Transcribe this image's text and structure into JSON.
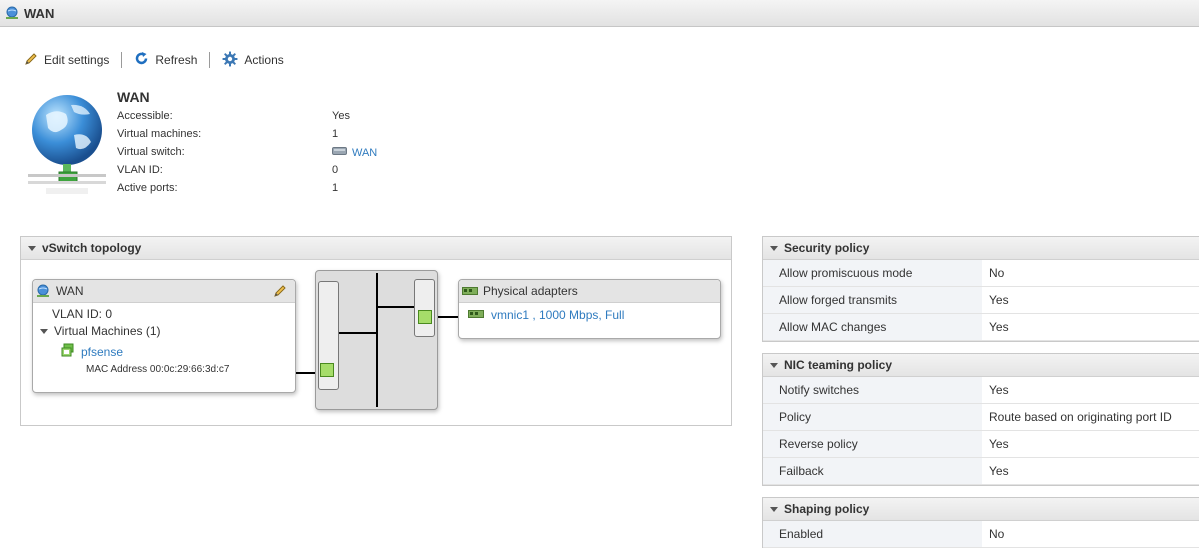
{
  "window": {
    "title": "WAN"
  },
  "toolbar": {
    "edit_label": "Edit settings",
    "refresh_label": "Refresh",
    "actions_label": "Actions"
  },
  "summary": {
    "name": "WAN",
    "fields": [
      {
        "label": "Accessible:",
        "value": "Yes"
      },
      {
        "label": "Virtual machines:",
        "value": "1"
      },
      {
        "label": "Virtual switch:",
        "value": "WAN"
      },
      {
        "label": "VLAN ID:",
        "value": "0"
      },
      {
        "label": "Active ports:",
        "value": "1"
      }
    ]
  },
  "topology": {
    "title": "vSwitch topology",
    "portgroup": {
      "name": "WAN",
      "vlan": "VLAN ID: 0",
      "vms_label": "Virtual Machines (1)",
      "vm_name": "pfsense",
      "mac": "MAC Address 00:0c:29:66:3d:c7"
    },
    "adapters": {
      "title": "Physical adapters",
      "nic": "vmnic1 , 1000 Mbps, Full"
    }
  },
  "security": {
    "title": "Security policy",
    "rows": [
      {
        "k": "Allow promiscuous mode",
        "v": "No"
      },
      {
        "k": "Allow forged transmits",
        "v": "Yes"
      },
      {
        "k": "Allow MAC changes",
        "v": "Yes"
      }
    ]
  },
  "nic": {
    "title": "NIC teaming policy",
    "rows": [
      {
        "k": "Notify switches",
        "v": "Yes"
      },
      {
        "k": "Policy",
        "v": "Route based on originating port ID"
      },
      {
        "k": "Reverse policy",
        "v": "Yes"
      },
      {
        "k": "Failback",
        "v": "Yes"
      }
    ]
  },
  "shaping": {
    "title": "Shaping policy",
    "rows": [
      {
        "k": "Enabled",
        "v": "No"
      }
    ]
  },
  "colors": {
    "link": "#2f7bbf",
    "port_green": "#a6dd6a",
    "header_bg": "#e4e4e4"
  }
}
